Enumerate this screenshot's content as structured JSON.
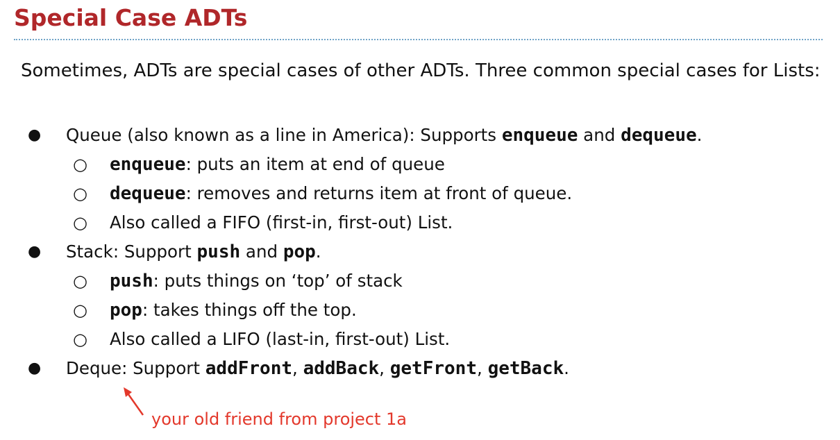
{
  "slide": {
    "title": "Special Case ADTs",
    "intro": "Sometimes, ADTs are special cases of other ADTs. Three common special cases for Lists:",
    "bullet_glyph": "●",
    "sub_bullet_glyph": "○"
  },
  "queue": {
    "text": "Queue (also known as a line in America): Supports ",
    "op1": "enqueue",
    "and": " and ",
    "op2": "dequeue",
    "end": ".",
    "enqueue": {
      "term": "enqueue",
      "desc": ": puts an item at end of queue"
    },
    "dequeue": {
      "term": "dequeue",
      "desc": ": removes and returns item at front of queue."
    },
    "note": "Also called a FIFO (first-in, first-out) List."
  },
  "stack": {
    "text": "Stack: Support ",
    "op1": "push",
    "and": " and ",
    "op2": "pop",
    "end": ".",
    "push": {
      "term": "push",
      "desc": ": puts things on ‘top’ of stack"
    },
    "pop": {
      "term": "pop",
      "desc": ": takes things off the top."
    },
    "note": "Also called a LIFO (last-in, first-out) List."
  },
  "deque": {
    "text": "Deque: Support ",
    "op1": "addFront",
    "sep1": ", ",
    "op2": "addBack",
    "sep2": ", ",
    "op3": "getFront",
    "sep3": ", ",
    "op4": "getBack",
    "end": "."
  },
  "annotation": {
    "text": "your old friend from project 1a",
    "color": "#e3382b"
  },
  "colors": {
    "title": "#b0272a",
    "divider": "#6fa3c7",
    "body_text": "#111111"
  }
}
